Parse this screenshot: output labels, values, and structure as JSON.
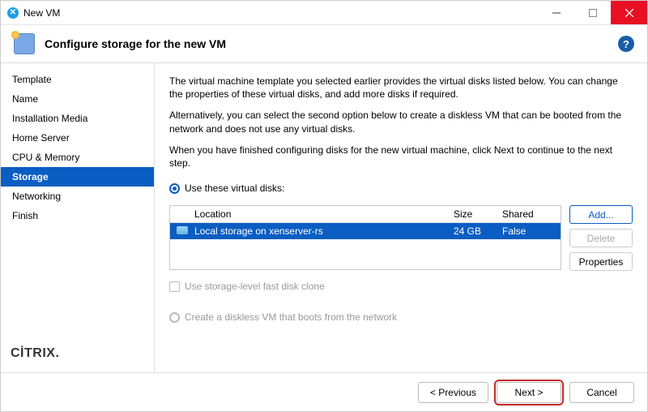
{
  "titlebar": {
    "title": "New VM"
  },
  "header": {
    "title": "Configure storage for the new VM"
  },
  "sidebar": {
    "items": [
      {
        "label": "Template"
      },
      {
        "label": "Name"
      },
      {
        "label": "Installation Media"
      },
      {
        "label": "Home Server"
      },
      {
        "label": "CPU & Memory"
      },
      {
        "label": "Storage"
      },
      {
        "label": "Networking"
      },
      {
        "label": "Finish"
      }
    ],
    "brand": "CİTRIX"
  },
  "content": {
    "para1": "The virtual machine template you selected earlier provides the virtual disks listed below. You can change the properties of these virtual disks, and add more disks if required.",
    "para2": "Alternatively, you can select the second option below to create a diskless VM that can be booted from the network and does not use any virtual disks.",
    "para3": "When you have finished configuring disks for the new virtual machine, click Next to continue to the next step.",
    "radio1_label": "Use these virtual disks:",
    "table": {
      "headers": {
        "location": "Location",
        "size": "Size",
        "shared": "Shared"
      },
      "rows": [
        {
          "location": "Local storage on xenserver-rs",
          "size": "24 GB",
          "shared": "False"
        }
      ]
    },
    "buttons": {
      "add": "Add...",
      "delete": "Delete",
      "properties": "Properties"
    },
    "checkbox_label": "Use storage-level fast disk clone",
    "radio2_label": "Create a diskless VM that boots from the network"
  },
  "footer": {
    "previous": "< Previous",
    "next": "Next >",
    "cancel": "Cancel"
  }
}
